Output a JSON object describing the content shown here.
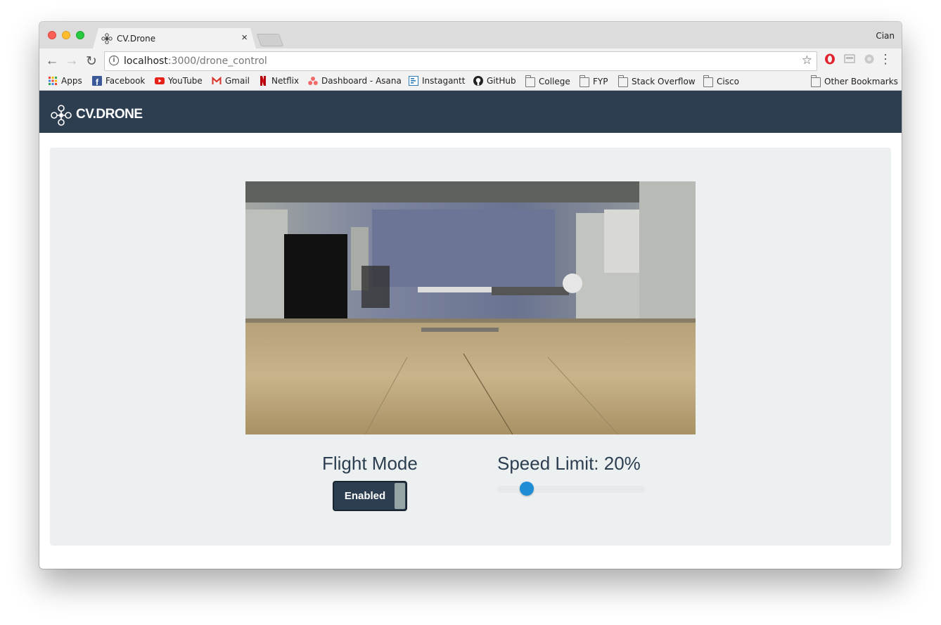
{
  "browser": {
    "user_name": "Cian",
    "tab_title": "CV.Drone",
    "tab_close": "×",
    "url_host": "localhost",
    "url_rest": ":3000/drone_control",
    "info_glyph": "i",
    "star_glyph": "☆",
    "back_glyph": "←",
    "forward_glyph": "→",
    "reload_glyph": "↻",
    "menu_glyph": "⋮"
  },
  "bookmarks": {
    "apps": "Apps",
    "facebook": "Facebook",
    "youtube": "YouTube",
    "gmail": "Gmail",
    "netflix": "Netflix",
    "asana": "Dashboard - Asana",
    "instagantt": "Instagantt",
    "github": "GitHub",
    "college": "College",
    "fyp": "FYP",
    "stackoverflow": "Stack Overflow",
    "cisco": "Cisco",
    "other": "Other Bookmarks"
  },
  "app": {
    "brand": "CV.DRONE"
  },
  "controls": {
    "flight_mode_label": "Flight Mode",
    "flight_mode_value": "Enabled",
    "speed_limit_label": "Speed Limit: 20%",
    "speed_limit_fraction": 0.15
  },
  "colors": {
    "navbar": "#2c3e50",
    "panel": "#ecf0f1",
    "slider_handle": "#1f8dd6",
    "toggle_knob": "#95a5a6"
  }
}
